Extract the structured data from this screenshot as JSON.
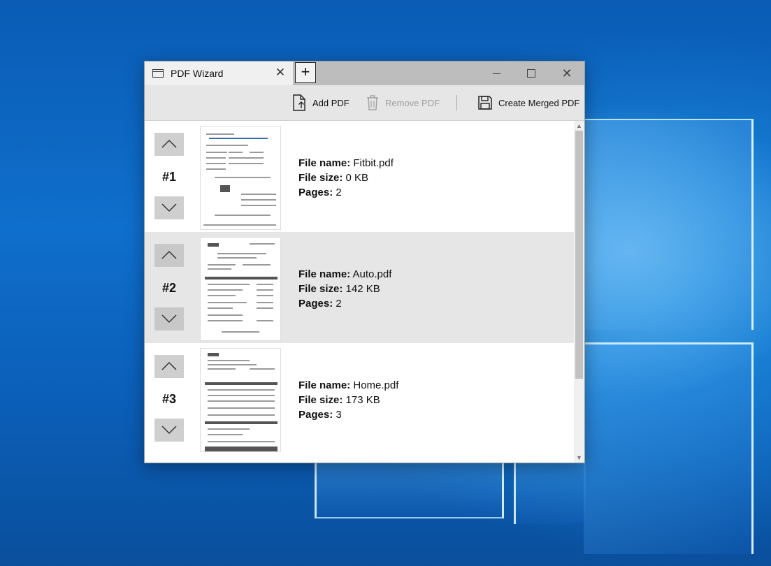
{
  "window": {
    "tab_title": "PDF Wizard",
    "tab_close_glyph": "✕",
    "new_tab_glyph": "+",
    "close_glyph": "✕"
  },
  "toolbar": {
    "add_label": "Add PDF",
    "remove_label": "Remove PDF",
    "create_label": "Create Merged PDF"
  },
  "labels": {
    "file_name": "File name:",
    "file_size": "File size:",
    "pages": "Pages:"
  },
  "files": [
    {
      "number": "#1",
      "name": "Fitbit.pdf",
      "size": "0 KB",
      "pages": "2"
    },
    {
      "number": "#2",
      "name": "Auto.pdf",
      "size": "142 KB",
      "pages": "2"
    },
    {
      "number": "#3",
      "name": "Home.pdf",
      "size": "173 KB",
      "pages": "3"
    }
  ],
  "icons": {
    "add": "add-file-icon",
    "remove": "trash-icon",
    "create": "save-icon",
    "up": "chevron-up-icon",
    "down": "chevron-down-icon"
  }
}
